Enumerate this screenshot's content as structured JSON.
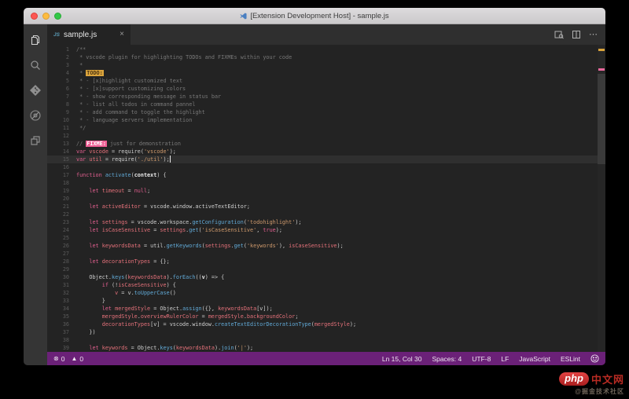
{
  "window": {
    "title": "[Extension Development Host] - sample.js"
  },
  "tab": {
    "icon": "JS",
    "label": "sample.js",
    "close": "×"
  },
  "editor_actions": {
    "preview": "open-preview",
    "split": "split-editor",
    "more": "⋯"
  },
  "activity_bar": {
    "items": [
      "explorer",
      "search",
      "source-control",
      "debug",
      "extensions"
    ]
  },
  "editor": {
    "current_line": 15,
    "cursor_line": 15,
    "lines": [
      {
        "num": "1",
        "tokens": [
          [
            "c",
            "/**"
          ]
        ]
      },
      {
        "num": "2",
        "tokens": [
          [
            "c",
            " * vscode plugin for highlighting TODOs and FIXMEs within your code"
          ]
        ]
      },
      {
        "num": "3",
        "tokens": [
          [
            "c",
            " *"
          ]
        ]
      },
      {
        "num": "4",
        "tokens": [
          [
            "c",
            " * "
          ],
          [
            "todo",
            "TODO:"
          ]
        ]
      },
      {
        "num": "5",
        "tokens": [
          [
            "c",
            " * - [x]highlight customized text"
          ]
        ]
      },
      {
        "num": "6",
        "tokens": [
          [
            "c",
            " * - [x]support customizing colors"
          ]
        ]
      },
      {
        "num": "7",
        "tokens": [
          [
            "c",
            " * - show corresponding message in status bar"
          ]
        ]
      },
      {
        "num": "8",
        "tokens": [
          [
            "c",
            " * - list all todos in command pannel"
          ]
        ]
      },
      {
        "num": "9",
        "tokens": [
          [
            "c",
            " * - add command to toggle the highlight"
          ]
        ]
      },
      {
        "num": "10",
        "tokens": [
          [
            "c",
            " * - language servers implementation"
          ]
        ]
      },
      {
        "num": "11",
        "tokens": [
          [
            "c",
            " */"
          ]
        ]
      },
      {
        "num": "12",
        "tokens": []
      },
      {
        "num": "13",
        "tokens": [
          [
            "c",
            "// "
          ],
          [
            "fixme",
            "FIXME:"
          ],
          [
            "c",
            " just for demonstration"
          ]
        ]
      },
      {
        "num": "14",
        "tokens": [
          [
            "k",
            "var"
          ],
          [
            "p",
            " "
          ],
          [
            "v",
            "vscode"
          ],
          [
            "p",
            " = require("
          ],
          [
            "s",
            "'vscode'"
          ],
          [
            "p",
            ");"
          ]
        ]
      },
      {
        "num": "15",
        "tokens": [
          [
            "k",
            "var"
          ],
          [
            "p",
            " "
          ],
          [
            "v",
            "util"
          ],
          [
            "p",
            " = require("
          ],
          [
            "s",
            "'./util'"
          ],
          [
            "p",
            ");"
          ]
        ]
      },
      {
        "num": "16",
        "tokens": []
      },
      {
        "num": "17",
        "tokens": [
          [
            "k",
            "function"
          ],
          [
            "p",
            " "
          ],
          [
            "m",
            "activate"
          ],
          [
            "p",
            "("
          ],
          [
            "b",
            "context"
          ],
          [
            "p",
            ") {"
          ]
        ]
      },
      {
        "num": "18",
        "tokens": []
      },
      {
        "num": "19",
        "tokens": [
          [
            "p",
            "    "
          ],
          [
            "k",
            "let"
          ],
          [
            "p",
            " "
          ],
          [
            "v",
            "timeout"
          ],
          [
            "p",
            " = "
          ],
          [
            "k",
            "null"
          ],
          [
            "p",
            ";"
          ]
        ]
      },
      {
        "num": "20",
        "tokens": []
      },
      {
        "num": "21",
        "tokens": [
          [
            "p",
            "    "
          ],
          [
            "k",
            "let"
          ],
          [
            "p",
            " "
          ],
          [
            "v",
            "activeEditor"
          ],
          [
            "p",
            " = vscode.window.activeTextEditor;"
          ]
        ]
      },
      {
        "num": "22",
        "tokens": []
      },
      {
        "num": "23",
        "tokens": [
          [
            "p",
            "    "
          ],
          [
            "k",
            "let"
          ],
          [
            "p",
            " "
          ],
          [
            "v",
            "settings"
          ],
          [
            "p",
            " = vscode.workspace."
          ],
          [
            "m",
            "getConfiguration"
          ],
          [
            "p",
            "("
          ],
          [
            "s",
            "'todohighlight'"
          ],
          [
            "p",
            ");"
          ]
        ]
      },
      {
        "num": "24",
        "tokens": [
          [
            "p",
            "    "
          ],
          [
            "k",
            "let"
          ],
          [
            "p",
            " "
          ],
          [
            "v",
            "isCaseSensitive"
          ],
          [
            "p",
            " = "
          ],
          [
            "v",
            "settings"
          ],
          [
            "p",
            "."
          ],
          [
            "m",
            "get"
          ],
          [
            "p",
            "("
          ],
          [
            "s",
            "'isCaseSensitive'"
          ],
          [
            "p",
            ", "
          ],
          [
            "k",
            "true"
          ],
          [
            "p",
            ");"
          ]
        ]
      },
      {
        "num": "25",
        "tokens": []
      },
      {
        "num": "26",
        "tokens": [
          [
            "p",
            "    "
          ],
          [
            "k",
            "let"
          ],
          [
            "p",
            " "
          ],
          [
            "v",
            "keywordsData"
          ],
          [
            "p",
            " = util."
          ],
          [
            "m",
            "getKeywords"
          ],
          [
            "p",
            "("
          ],
          [
            "v",
            "settings"
          ],
          [
            "p",
            "."
          ],
          [
            "m",
            "get"
          ],
          [
            "p",
            "("
          ],
          [
            "s",
            "'keywords'"
          ],
          [
            "p",
            "), "
          ],
          [
            "v",
            "isCaseSensitive"
          ],
          [
            "p",
            ");"
          ]
        ]
      },
      {
        "num": "27",
        "tokens": []
      },
      {
        "num": "28",
        "tokens": [
          [
            "p",
            "    "
          ],
          [
            "k",
            "let"
          ],
          [
            "p",
            " "
          ],
          [
            "v",
            "decorationTypes"
          ],
          [
            "p",
            " = {};"
          ]
        ]
      },
      {
        "num": "29",
        "tokens": []
      },
      {
        "num": "30",
        "tokens": [
          [
            "p",
            "    Object."
          ],
          [
            "m",
            "keys"
          ],
          [
            "p",
            "("
          ],
          [
            "v",
            "keywordsData"
          ],
          [
            "p",
            ")."
          ],
          [
            "m",
            "forEach"
          ],
          [
            "p",
            "(("
          ],
          [
            "b",
            "v"
          ],
          [
            "p",
            ") => {"
          ]
        ]
      },
      {
        "num": "31",
        "tokens": [
          [
            "p",
            "        "
          ],
          [
            "k",
            "if"
          ],
          [
            "p",
            " (!"
          ],
          [
            "v",
            "isCaseSensitive"
          ],
          [
            "p",
            ") {"
          ]
        ]
      },
      {
        "num": "32",
        "tokens": [
          [
            "p",
            "            "
          ],
          [
            "v",
            "v"
          ],
          [
            "p",
            " = v."
          ],
          [
            "m",
            "toUpperCase"
          ],
          [
            "p",
            "()"
          ]
        ]
      },
      {
        "num": "33",
        "tokens": [
          [
            "p",
            "        }"
          ]
        ]
      },
      {
        "num": "34",
        "tokens": [
          [
            "p",
            "        "
          ],
          [
            "k",
            "let"
          ],
          [
            "p",
            " "
          ],
          [
            "v",
            "mergedStyle"
          ],
          [
            "p",
            " = Object."
          ],
          [
            "m",
            "assign"
          ],
          [
            "p",
            "({}, "
          ],
          [
            "v",
            "keywordsData"
          ],
          [
            "p",
            "[v]);"
          ]
        ]
      },
      {
        "num": "35",
        "tokens": [
          [
            "p",
            "        "
          ],
          [
            "v",
            "mergedStyle"
          ],
          [
            "p",
            "."
          ],
          [
            "v",
            "overviewRulerColor"
          ],
          [
            "p",
            " = "
          ],
          [
            "v",
            "mergedStyle"
          ],
          [
            "p",
            "."
          ],
          [
            "v",
            "backgroundColor"
          ],
          [
            "p",
            ";"
          ]
        ]
      },
      {
        "num": "36",
        "tokens": [
          [
            "p",
            "        "
          ],
          [
            "v",
            "decorationTypes"
          ],
          [
            "p",
            "[v] = vscode.window."
          ],
          [
            "m",
            "createTextEditorDecorationType"
          ],
          [
            "p",
            "("
          ],
          [
            "v",
            "mergedStyle"
          ],
          [
            "p",
            ");"
          ]
        ]
      },
      {
        "num": "37",
        "tokens": [
          [
            "p",
            "    })"
          ]
        ]
      },
      {
        "num": "38",
        "tokens": []
      },
      {
        "num": "39",
        "tokens": [
          [
            "p",
            "    "
          ],
          [
            "k",
            "let"
          ],
          [
            "p",
            " "
          ],
          [
            "v",
            "keywords"
          ],
          [
            "p",
            " = Object."
          ],
          [
            "m",
            "keys"
          ],
          [
            "p",
            "("
          ],
          [
            "v",
            "keywordsData"
          ],
          [
            "p",
            ")."
          ],
          [
            "m",
            "join"
          ],
          [
            "p",
            "("
          ],
          [
            "s",
            "'|'"
          ],
          [
            "p",
            ");"
          ]
        ]
      }
    ]
  },
  "status_bar": {
    "errors": "0",
    "warnings": "0",
    "cursor": "Ln 15, Col 30",
    "spaces": "Spaces: 4",
    "encoding": "UTF-8",
    "eol": "LF",
    "language": "JavaScript",
    "linter": "ESLint"
  },
  "watermark": {
    "logo": "php",
    "site": "中文网",
    "subtitle": "@掘金技术社区"
  },
  "colors": {
    "statusbar": "#6b2178",
    "todo_badge": "#dba43c",
    "fixme_badge": "#ef5e94",
    "keyword": "#e15f8f",
    "string": "#cf9a6c",
    "method": "#61a9d6",
    "comment": "#787878"
  }
}
